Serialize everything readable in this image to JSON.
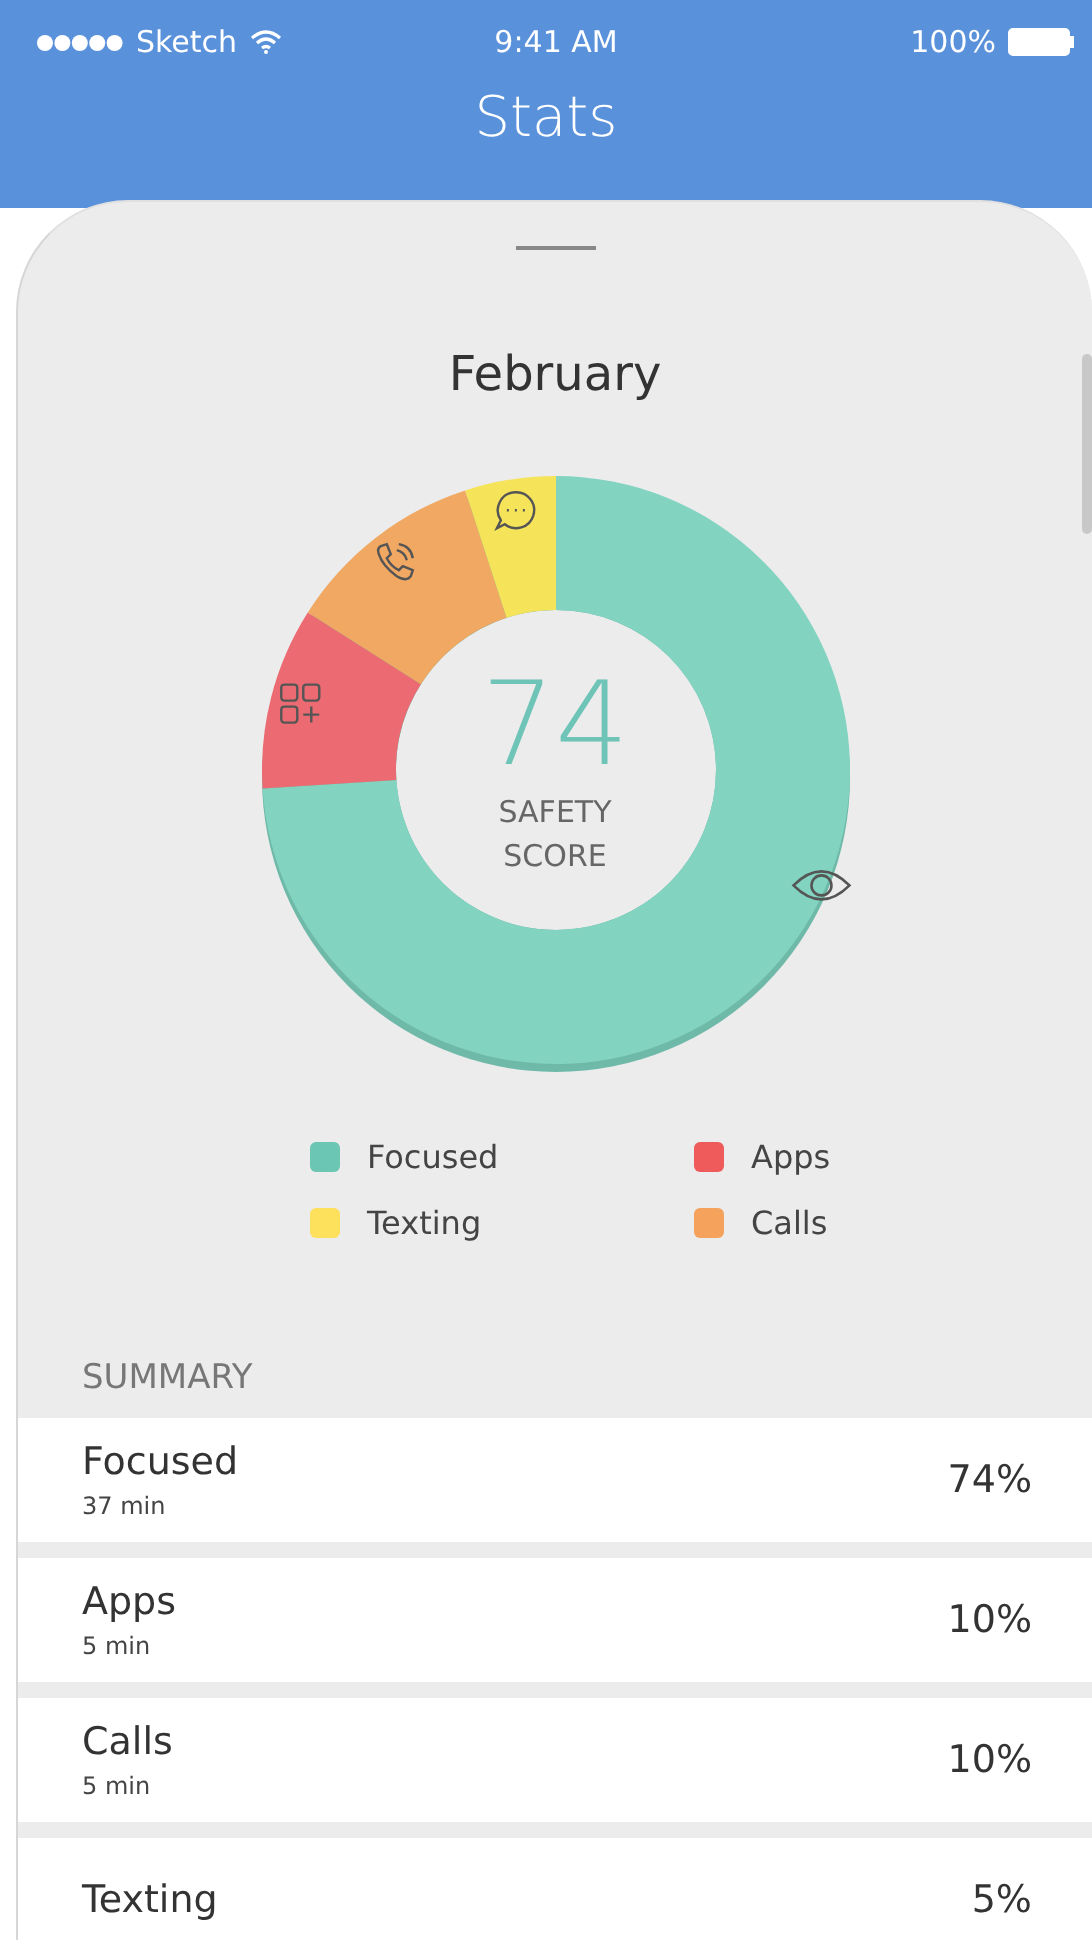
{
  "status_bar": {
    "carrier": "Sketch",
    "time": "9:41 AM",
    "battery": "100%"
  },
  "nav": {
    "title": "Stats"
  },
  "month": "February",
  "score": {
    "value": "74",
    "label": "SAFETY SCORE"
  },
  "legend": [
    {
      "label": "Focused",
      "color": "#6cc6b4"
    },
    {
      "label": "Apps",
      "color": "#ef5b5b"
    },
    {
      "label": "Texting",
      "color": "#fde05c"
    },
    {
      "label": "Calls",
      "color": "#f4a25c"
    }
  ],
  "summary": {
    "title": "SUMMARY",
    "rows": [
      {
        "name": "Focused",
        "time": "37 min",
        "percent": "74%"
      },
      {
        "name": "Apps",
        "time": "5 min",
        "percent": "10%"
      },
      {
        "name": "Calls",
        "time": "5 min",
        "percent": "10%"
      },
      {
        "name": "Texting",
        "percent": "5%"
      }
    ]
  }
}
